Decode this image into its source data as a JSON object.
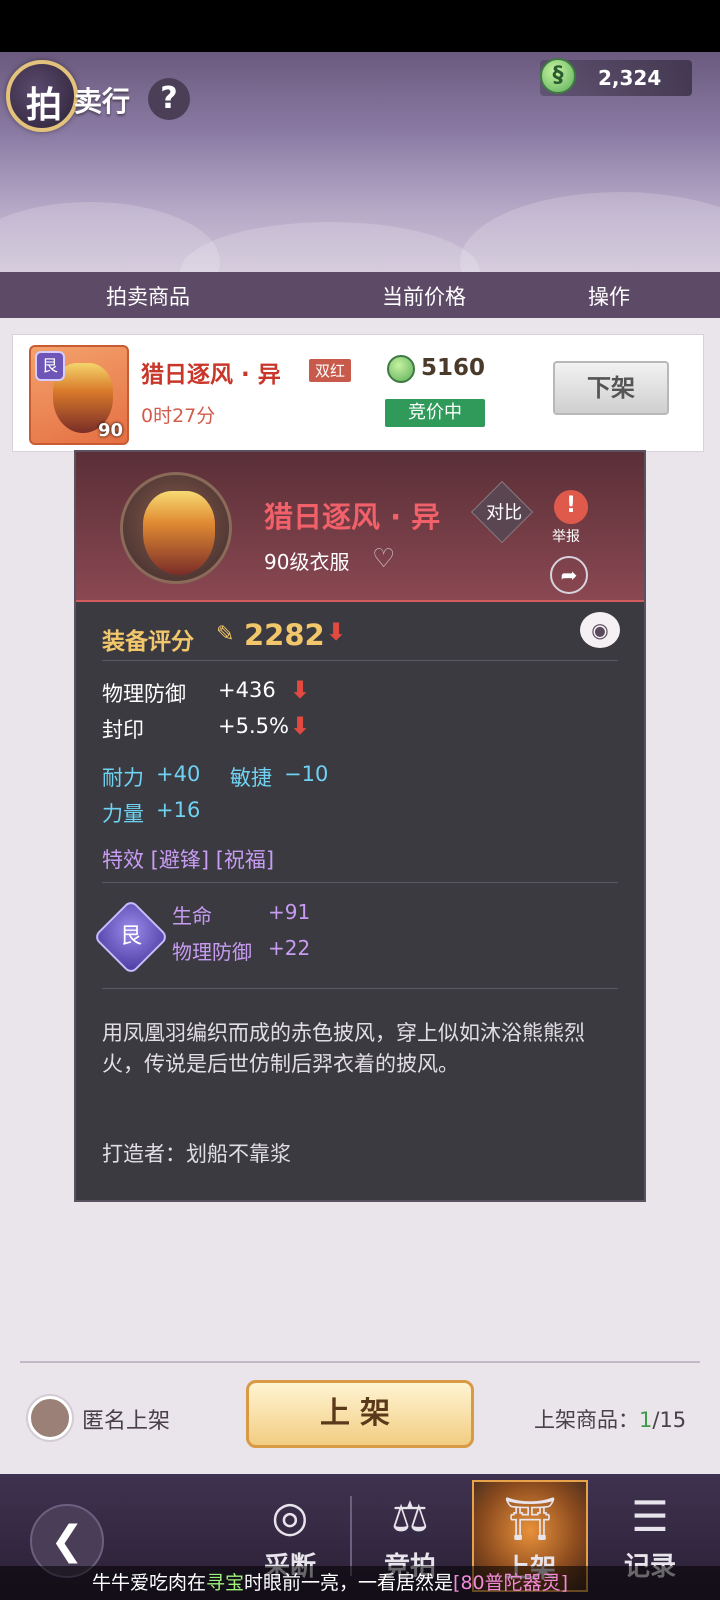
{
  "header": {
    "title_char": "拍",
    "title_rest": "卖行",
    "help": "?",
    "currency_value": "2,324"
  },
  "columns": [
    "拍卖商品",
    "当前价格",
    "操作"
  ],
  "listing": {
    "grade": "艮",
    "level": "90",
    "name": "猎日逐风 · 异",
    "tag": "双红",
    "time_left": "0时27分",
    "price": "5160",
    "status": "竞价中",
    "delist_label": "下架"
  },
  "detail": {
    "name": "猎日逐风 · 异",
    "subtitle": "90级衣服",
    "compare_label": "对比",
    "report_label": "举报",
    "score_label": "装备评分",
    "score_value": "2282",
    "base_stats": [
      {
        "name": "物理防御",
        "value": "+436"
      },
      {
        "name": "封印",
        "value": "+5.5%"
      }
    ],
    "attr_row1": [
      {
        "name": "耐力",
        "value": "+40"
      },
      {
        "name": "敏捷",
        "value": "−10"
      }
    ],
    "attr_row2": [
      {
        "name": "力量",
        "value": "+16"
      }
    ],
    "effect": "特效 [避锋] [祝福]",
    "gem": {
      "glyph": "艮",
      "stats": [
        {
          "name": "生命",
          "value": "+91"
        },
        {
          "name": "物理防御",
          "value": "+22"
        }
      ]
    },
    "description": "用凤凰羽编织而成的赤色披风，穿上似如沐浴熊熊烈火，传说是后世仿制后羿衣着的披风。",
    "crafter": "打造者：划船不靠浆"
  },
  "footer": {
    "anon_label": "匿名上架",
    "list_button": "上架",
    "listed_label": "上架商品：",
    "listed_count": "1",
    "listed_total": "/15"
  },
  "nav": {
    "items": [
      "采断",
      "竞拍",
      "上架",
      "记录"
    ],
    "active": "上架"
  },
  "ticker": {
    "part1": "牛牛爱吃肉在",
    "part2": "寻宝",
    "part3": "时眼前一亮，一看居然是",
    "part4": "[80普陀器灵]"
  },
  "colors": {
    "accent_red": "#c8372a",
    "price_green": "#2f9a59",
    "score_gold": "#f2c66a",
    "attr_blue": "#6fd2f2",
    "effect_purple": "#c79cf2"
  }
}
